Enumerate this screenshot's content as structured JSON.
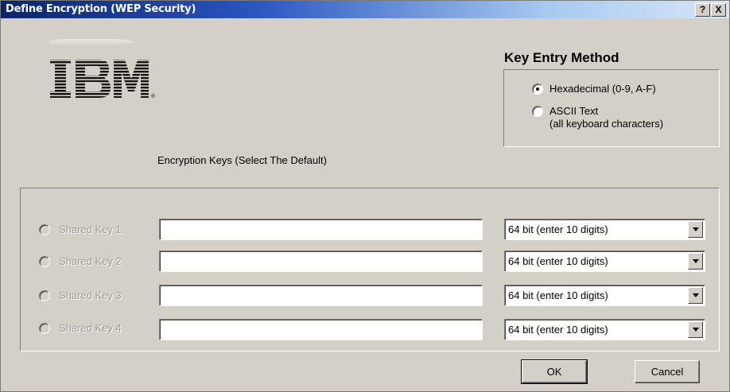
{
  "window": {
    "title": "Define Encryption (WEP Security)",
    "help_label": "?",
    "close_label": "X"
  },
  "logo": {
    "text": "IBM",
    "registered_mark": "®"
  },
  "encryption_keys_label": "Encryption Keys (Select The Default)",
  "key_entry": {
    "title": "Key Entry Method",
    "options": [
      {
        "label": "Hexadecimal (0-9, A-F)",
        "selected": true
      },
      {
        "label_line1": "ASCII Text",
        "label_line2": "(all keyboard characters)",
        "selected": false
      }
    ]
  },
  "shared_keys": [
    {
      "label": "Shared Key 1",
      "value": "",
      "length": "64 bit (enter 10 digits)",
      "enabled": false
    },
    {
      "label": "Shared Key 2",
      "value": "",
      "length": "64 bit (enter 10 digits)",
      "enabled": false
    },
    {
      "label": "Shared Key 3",
      "value": "",
      "length": "64 bit (enter 10 digits)",
      "enabled": false
    },
    {
      "label": "Shared Key 4",
      "value": "",
      "length": "64 bit (enter 10 digits)",
      "enabled": false
    }
  ],
  "buttons": {
    "ok": "OK",
    "cancel": "Cancel"
  },
  "colors": {
    "titlebar_start": "#0a246a",
    "titlebar_end": "#d8e6f6",
    "face": "#d4d0c8",
    "disabled_text": "#a09c94"
  }
}
